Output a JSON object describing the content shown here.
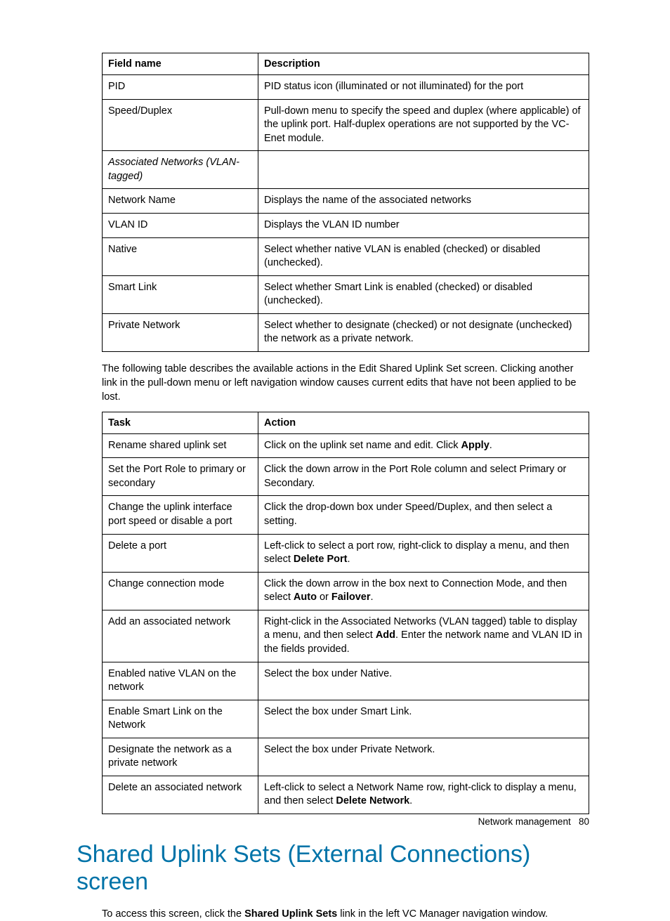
{
  "table1": {
    "headers": {
      "col1": "Field name",
      "col2": "Description"
    },
    "rows": [
      {
        "c1": "PID",
        "c2": "PID status icon (illuminated or not illuminated) for the port"
      },
      {
        "c1": "Speed/Duplex",
        "c2": "Pull-down menu to specify the speed and duplex (where applicable) of the uplink port. Half-duplex operations are not supported by the VC-Enet module."
      },
      {
        "c1": "Associated Networks (VLAN-tagged)",
        "c2": "",
        "italic": true
      },
      {
        "c1": "Network Name",
        "c2": "Displays the name of the associated networks"
      },
      {
        "c1": "VLAN ID",
        "c2": "Displays the VLAN ID number"
      },
      {
        "c1": "Native",
        "c2": "Select whether native VLAN is enabled (checked) or disabled (unchecked)."
      },
      {
        "c1": "Smart Link",
        "c2": "Select whether Smart Link is enabled (checked) or disabled (unchecked)."
      },
      {
        "c1": "Private Network",
        "c2": "Select whether to designate (checked) or not designate (unchecked) the network as a private network."
      }
    ]
  },
  "para1": "The following table describes the available actions in the Edit Shared Uplink Set screen. Clicking another link in the pull-down menu or left navigation window causes current edits that have not been applied to be lost.",
  "table2": {
    "headers": {
      "col1": "Task",
      "col2": "Action"
    },
    "rows": [
      {
        "c1": "Rename shared uplink set",
        "pre": "Click on the uplink set name and edit. Click ",
        "b1": "Apply",
        "post": "."
      },
      {
        "c1": "Set the Port Role to primary or secondary",
        "pre": "Click the down arrow in the Port Role column and select Primary or Secondary."
      },
      {
        "c1": "Change the uplink interface port speed or disable a port",
        "pre": "Click the drop-down box under Speed/Duplex, and then select a setting."
      },
      {
        "c1": "Delete a port",
        "pre": "Left-click to select a port row, right-click to display a menu, and then select ",
        "b1": "Delete Port",
        "post": "."
      },
      {
        "c1": "Change connection mode",
        "pre": "Click the down arrow in the box next to Connection Mode, and then select ",
        "b1": "Auto",
        "mid": " or ",
        "b2": "Failover",
        "post": "."
      },
      {
        "c1": "Add an associated network",
        "pre": "Right-click in the Associated Networks (VLAN tagged) table to display a menu, and then select ",
        "b1": "Add",
        "post": ". Enter the network name and VLAN ID in the fields provided."
      },
      {
        "c1": "Enabled native VLAN on the network",
        "pre": "Select the box under Native."
      },
      {
        "c1": "Enable Smart Link on the Network",
        "pre": "Select the box under Smart Link."
      },
      {
        "c1": "Designate the network as a private network",
        "pre": "Select the box under Private Network."
      },
      {
        "c1": "Delete an associated network",
        "pre": "Left-click to select a Network Name row, right-click to display a menu, and then select ",
        "b1": "Delete Network",
        "post": "."
      }
    ]
  },
  "heading": "Shared Uplink Sets (External Connections) screen",
  "para2": {
    "pre": "To access this screen, click the ",
    "b": "Shared Uplink Sets",
    "post": " link in the left VC Manager navigation window."
  },
  "footer": {
    "label": "Network management",
    "page": "80"
  }
}
